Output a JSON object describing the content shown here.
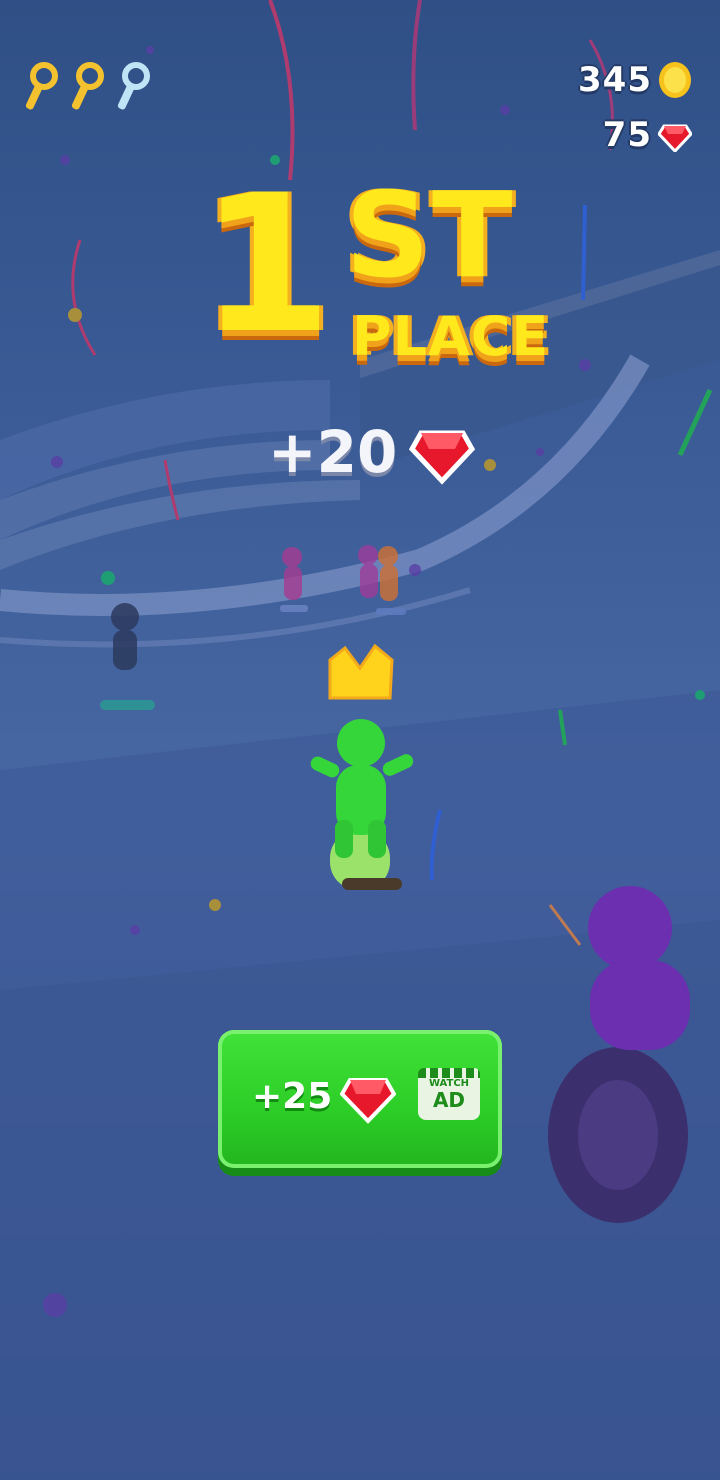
{
  "hud": {
    "keys": [
      {
        "state": "collected",
        "icon": "key-icon",
        "color": "#f3c22e"
      },
      {
        "state": "collected",
        "icon": "key-icon",
        "color": "#f3c22e"
      },
      {
        "state": "empty",
        "icon": "key-icon",
        "color": "#bfe4f5"
      }
    ],
    "coins": "345",
    "coin_icon": "coin-icon",
    "gems": "75",
    "gem_icon": "gem-icon"
  },
  "result": {
    "place_number": "1",
    "place_suffix": "ST",
    "place_word": "PLACE",
    "reward_text": "+20",
    "reward_icon": "gem-icon"
  },
  "ad_button": {
    "reward_text": "+25",
    "reward_icon": "gem-icon",
    "watch_label": "WATCH",
    "ad_label": "AD"
  },
  "colors": {
    "title_yellow": "#ffe81c",
    "gem_red": "#e8182c",
    "button_green": "#2ccd26",
    "player_green": "#35d63a"
  }
}
